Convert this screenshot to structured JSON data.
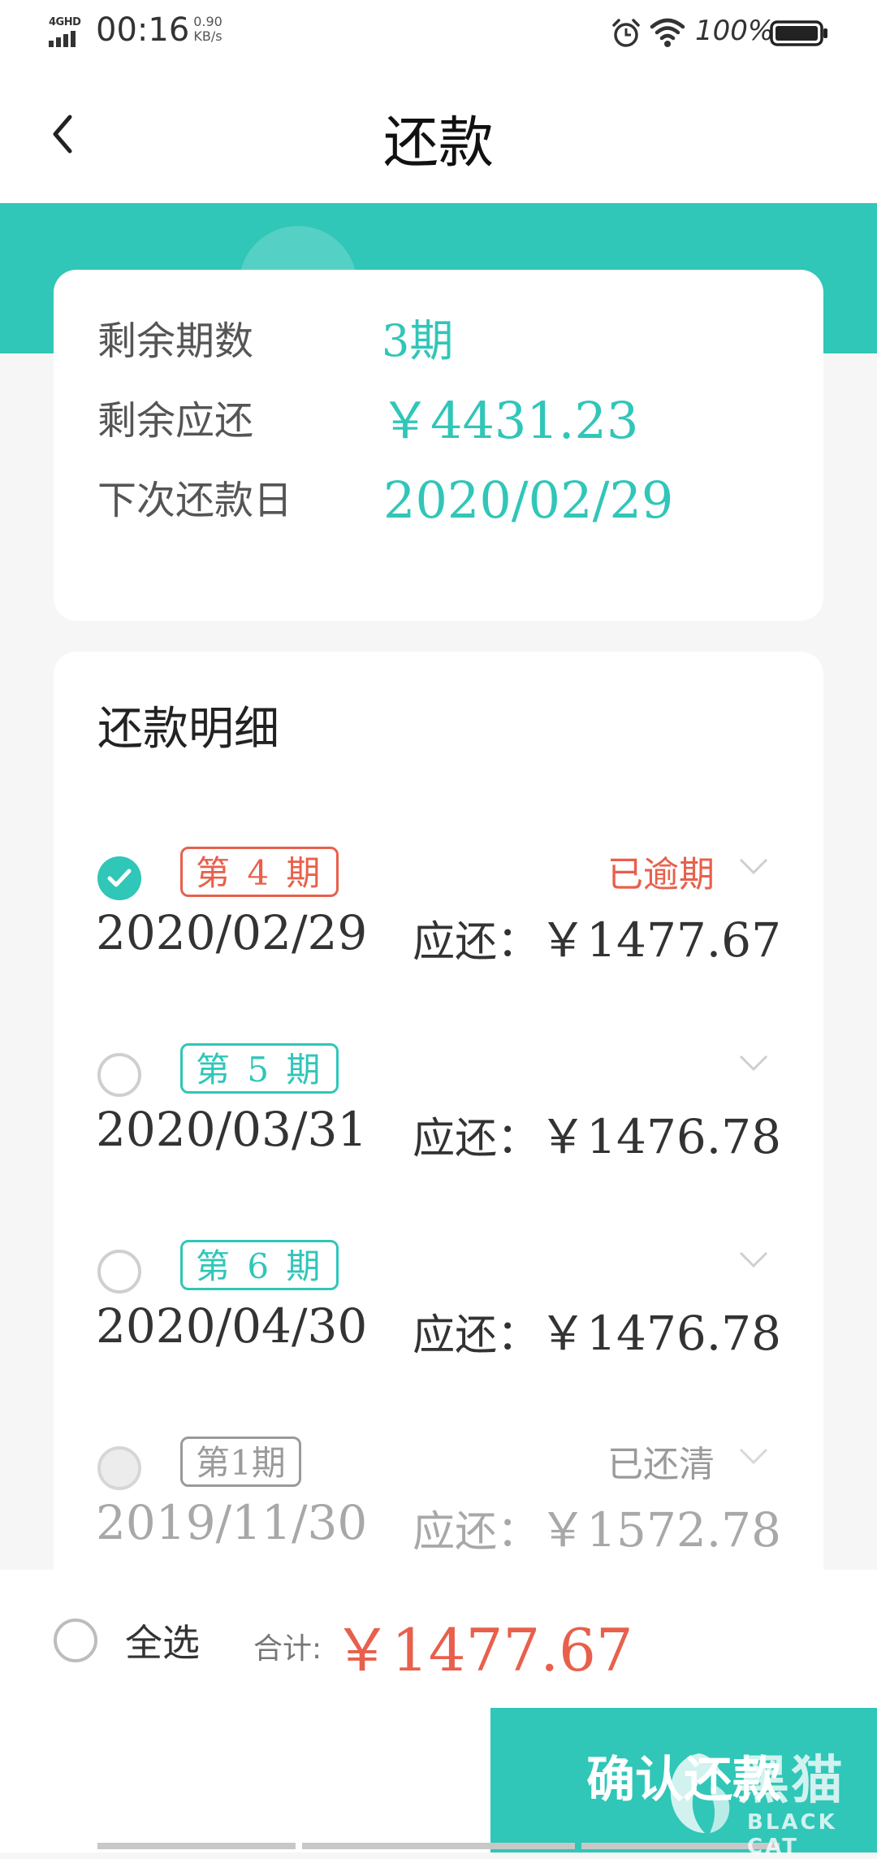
{
  "status_bar": {
    "network": "4GHD",
    "time": "00:16",
    "speed_value": "0.90",
    "speed_unit": "KB/s",
    "battery_percent": "100%",
    "icons": [
      "signal-icon",
      "alarm-icon",
      "wifi-icon",
      "battery-icon"
    ]
  },
  "header": {
    "title": "还款",
    "back_icon": "chevron-left-icon"
  },
  "summary": {
    "remaining_periods_label": "剩余期数",
    "remaining_periods_value": "3期",
    "remaining_due_label": "剩余应还",
    "remaining_due_value": "￥4431.23",
    "next_date_label": "下次还款日",
    "next_date_value": "2020/02/29"
  },
  "details": {
    "title": "还款明细",
    "items": [
      {
        "period": "第 4 期",
        "status": "已逾期",
        "date": "2020/02/29",
        "due_label": "应还：",
        "amount": "￥1477.67"
      },
      {
        "period": "第 5 期",
        "status": "",
        "date": "2020/03/31",
        "due_label": "应还：",
        "amount": "￥1476.78"
      },
      {
        "period": "第 6 期",
        "status": "",
        "date": "2020/04/30",
        "due_label": "应还：",
        "amount": "￥1476.78"
      },
      {
        "period": "第1期",
        "status": "已还清",
        "date": "2019/11/30",
        "due_label": "应还：",
        "amount": "￥1572.78"
      }
    ]
  },
  "footer": {
    "select_all_label": "全选",
    "total_label": "合计:",
    "total_value": "￥1477.67",
    "confirm_label": "确认还款"
  },
  "watermark": {
    "cn_text": "黑猫",
    "en_text": "BLACK CAT"
  },
  "colors": {
    "accent": "#30c6b8",
    "overdue": "#e8604c",
    "paid": "#9a9a9a",
    "background": "#f6f6f6"
  }
}
